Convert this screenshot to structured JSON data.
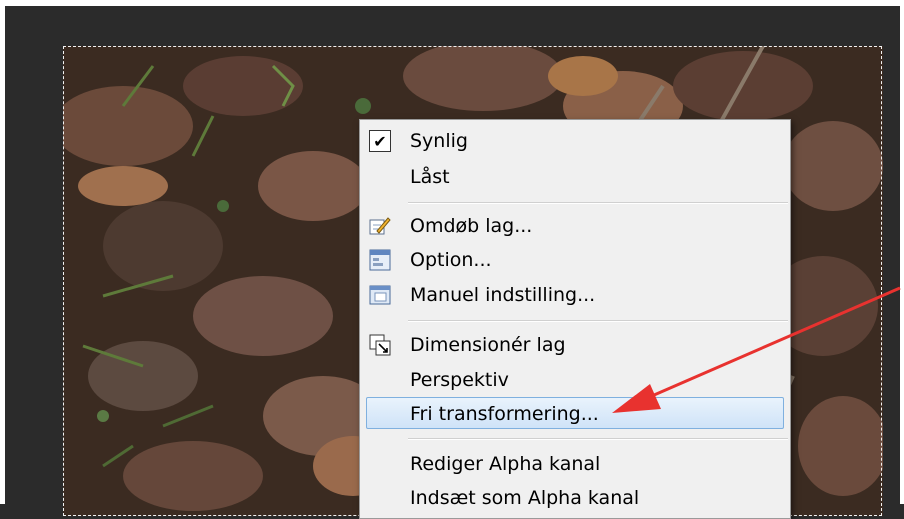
{
  "context_menu": {
    "items": [
      {
        "label": "Synlig",
        "icon": "checkbox-checked-icon",
        "checked": true
      },
      {
        "label": "Låst",
        "icon": null
      },
      {
        "label": "Omdøb lag...",
        "icon": "rename-pencil-icon"
      },
      {
        "label": "Option...",
        "icon": "options-window-icon"
      },
      {
        "label": "Manuel indstilling...",
        "icon": "manual-settings-icon"
      },
      {
        "label": "Dimensionér lag",
        "icon": "resize-layer-icon"
      },
      {
        "label": "Perspektiv",
        "icon": null
      },
      {
        "label": "Fri transformering...",
        "icon": null,
        "highlighted": true
      },
      {
        "label": "Rediger Alpha kanal",
        "icon": null
      },
      {
        "label": "Indsæt som Alpha kanal",
        "icon": null
      }
    ],
    "highlight_color": "#cfe3f8"
  },
  "annotation": {
    "arrow_color": "#e8322f",
    "points_to": "Fri transformering..."
  },
  "canvas": {
    "content": "photo-leaves-forest-floor"
  }
}
